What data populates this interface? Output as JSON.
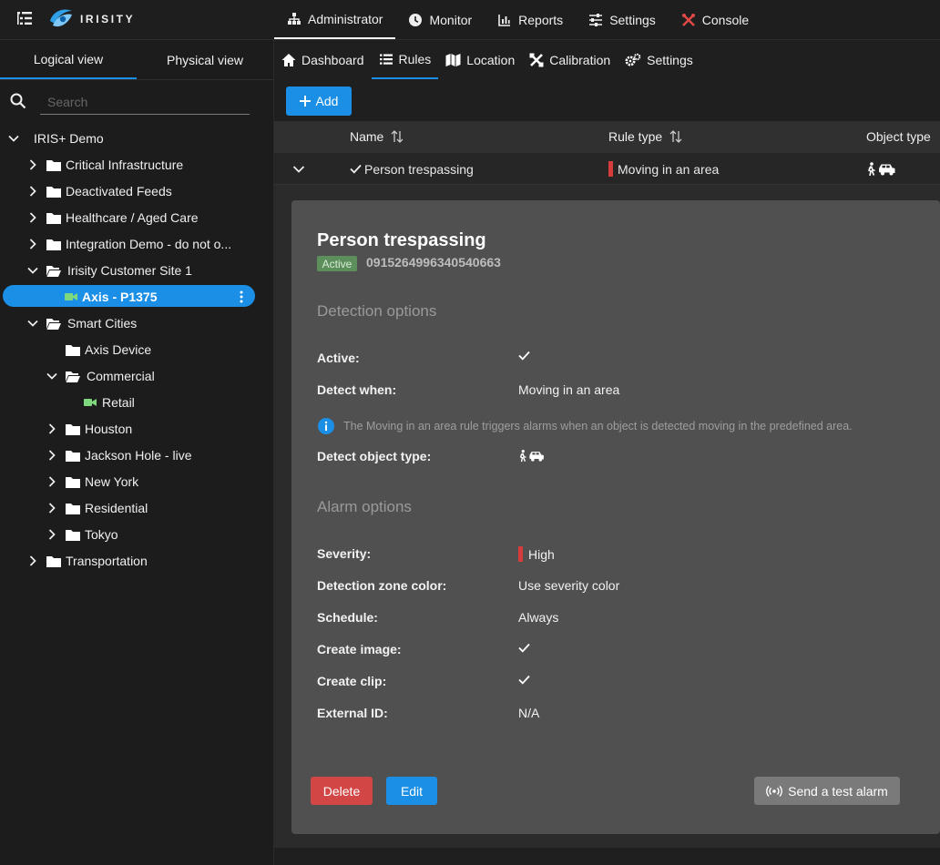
{
  "brand": {
    "name": "IRISITY",
    "accent": "#1b8fe6"
  },
  "topnav": [
    {
      "label": "Administrator",
      "icon": "sitemap-icon"
    },
    {
      "label": "Monitor",
      "icon": "clock-icon"
    },
    {
      "label": "Reports",
      "icon": "chart-icon"
    },
    {
      "label": "Settings",
      "icon": "sliders-icon"
    },
    {
      "label": "Console",
      "icon": "tools-icon"
    }
  ],
  "sidebar": {
    "tabs": [
      "Logical view",
      "Physical view"
    ],
    "search_placeholder": "Search",
    "tree": [
      {
        "label": "IRIS+ Demo"
      },
      {
        "label": "Critical Infrastructure"
      },
      {
        "label": "Deactivated Feeds"
      },
      {
        "label": "Healthcare / Aged Care"
      },
      {
        "label": "Integration Demo - do not o..."
      },
      {
        "label": "Irisity Customer Site 1"
      },
      {
        "label": "Axis - P1375"
      },
      {
        "label": "Smart Cities"
      },
      {
        "label": "Axis Device"
      },
      {
        "label": "Commercial"
      },
      {
        "label": "Retail"
      },
      {
        "label": "Houston"
      },
      {
        "label": "Jackson Hole - live"
      },
      {
        "label": "New York"
      },
      {
        "label": "Residential"
      },
      {
        "label": "Tokyo"
      },
      {
        "label": "Transportation"
      }
    ]
  },
  "subnav": [
    {
      "label": "Dashboard",
      "icon": "home-icon"
    },
    {
      "label": "Rules",
      "icon": "list-icon"
    },
    {
      "label": "Location",
      "icon": "map-icon"
    },
    {
      "label": "Calibration",
      "icon": "calibration-icon"
    },
    {
      "label": "Settings",
      "icon": "gears-icon"
    }
  ],
  "add_label": "Add",
  "table": {
    "headers": {
      "name": "Name",
      "rule_type": "Rule type",
      "object_type": "Object type"
    },
    "row": {
      "name": "Person trespassing",
      "rule_type": "Moving in an area"
    }
  },
  "detail": {
    "title": "Person trespassing",
    "status": "Active",
    "id": "0915264996340540663",
    "detection_title": "Detection options",
    "active_label": "Active:",
    "detect_when_label": "Detect when:",
    "detect_when_value": "Moving in an area",
    "info_text": "The Moving in an area rule triggers alarms when an object is detected moving in the predefined area.",
    "object_type_label": "Detect object type:",
    "alarm_title": "Alarm options",
    "severity_label": "Severity:",
    "severity_value": "High",
    "zone_color_label": "Detection zone color:",
    "zone_color_value": "Use severity color",
    "schedule_label": "Schedule:",
    "schedule_value": "Always",
    "create_image_label": "Create image:",
    "create_clip_label": "Create clip:",
    "external_id_label": "External ID:",
    "external_id_value": "N/A",
    "severity_color": "#d63c3c"
  },
  "buttons": {
    "delete": "Delete",
    "edit": "Edit",
    "test_alarm": "Send a test alarm"
  }
}
